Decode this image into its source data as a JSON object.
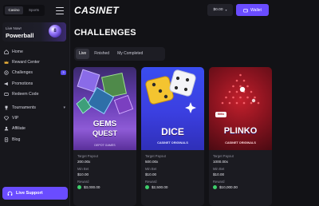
{
  "sidebar": {
    "modes": [
      "Casino",
      "Sports"
    ],
    "promo": {
      "small": "Live Now!",
      "big": "Powerball",
      "ball_number": "8"
    },
    "items": [
      {
        "label": "Home",
        "icon": "home-icon"
      },
      {
        "label": "Reward Center",
        "icon": "crown-icon"
      },
      {
        "label": "Challenges",
        "icon": "challenge-icon",
        "badge": "3"
      },
      {
        "label": "Promotions",
        "icon": "megaphone-icon"
      },
      {
        "label": "Redeem Code",
        "icon": "ticket-icon"
      },
      {
        "label": "Tournaments",
        "icon": "trophy-icon"
      },
      {
        "label": "VIP",
        "icon": "diamond-icon"
      },
      {
        "label": "Affiliate",
        "icon": "user-icon"
      },
      {
        "label": "Blog",
        "icon": "document-icon"
      }
    ],
    "live_support": "Live Support"
  },
  "header": {
    "logo": "CASINET",
    "balance": "$0.00",
    "wallet_label": "Wallet"
  },
  "main": {
    "title": "CHALLENGES",
    "tabs": [
      "Live",
      "Finished",
      "My Completed"
    ],
    "cards": [
      {
        "game_title_1": "GEMS",
        "game_title_2": "QUEST",
        "game_sub": "DEPOT GAMES",
        "target_payout_label": "Target Payout",
        "target_payout": "200.00x",
        "min_bet_label": "Min Bet",
        "min_bet": "$10.00",
        "reward_label": "Reward",
        "reward": "$3,000.00"
      },
      {
        "game_title_1": "DICE",
        "game_sub": "CASINET ORIGINALS",
        "target_payout_label": "Target Payout",
        "target_payout": "500.00x",
        "min_bet_label": "Min Bet",
        "min_bet": "$10.00",
        "reward_label": "Reward",
        "reward": "$2,500.00"
      },
      {
        "game_title_1": "PLINKO",
        "game_sub": "CASINET ORIGINALS",
        "multiplier": "500x",
        "target_payout_label": "Target Payout",
        "target_payout": "1000.00x",
        "min_bet_label": "Min Bet",
        "min_bet": "$10.00",
        "reward_label": "Reward",
        "reward": "$10,000.00"
      }
    ]
  },
  "colors": {
    "accent": "#6a4cff",
    "background": "#121216",
    "sidebar": "#17171c",
    "reward_coin": "#3ecf6b"
  }
}
